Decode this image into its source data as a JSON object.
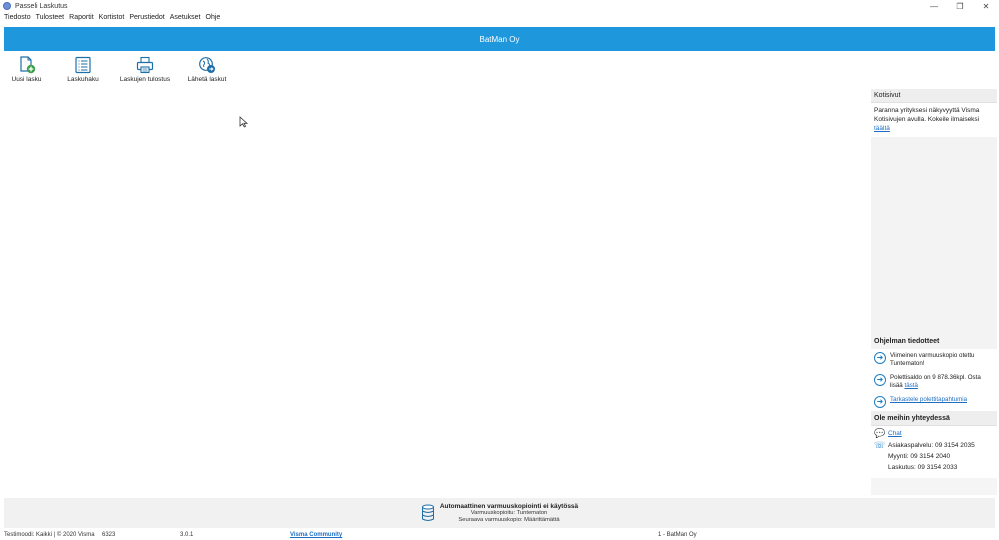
{
  "window": {
    "title": "Passeli Laskutus",
    "controls": [
      "—",
      "❐",
      "✕"
    ]
  },
  "menu": [
    "Tiedosto",
    "Tulosteet",
    "Raportit",
    "Kortistot",
    "Perustiedot",
    "Asetukset",
    "Ohje"
  ],
  "header": {
    "title": "BatMan Oy"
  },
  "toolbar": {
    "new_invoice": "Uusi lasku",
    "invoice_search": "Laskuhaku",
    "invoice_print": "Laskujen tulostus",
    "send_invoices": "Lähetä laskut"
  },
  "colors": {
    "accent": "#1e97dc",
    "link": "#1e6fc4"
  },
  "right_panel": {
    "kotisivut_title": "Kotisivut",
    "kotisivut_text": "Paranna yrityksesi näkyvyyttä Visma Kotisivujen avulla. Kokeile ilmaiseksi",
    "kotisivut_link": "täältä",
    "info_title": "Ohjelman tiedotteet",
    "info_backup": "Viimeinen varmuuskopio otettu Tuntematon!",
    "info_balance": "Polettisaldo on 9 878.36kpl. Osta lisää",
    "info_balance_link": "tästä",
    "info_events_link": "Tarkastele polettitapahtumia",
    "contact_title": "Ole meihin yhteydessä",
    "chat_link": "Chat",
    "support": "Asiakaspalvelu: 09 3154 2035",
    "sales": "Myynti: 09 3154 2040",
    "billing": "Laskutus: 09 3154 2033"
  },
  "backup": {
    "title": "Automaattinen varmuuskopiointi ei käytössä",
    "line1": "Varmuuskopioitu: Tuntematon",
    "line2": "Seuraava varmuuskopio: Määrittämättä"
  },
  "status": {
    "mode": "Testimoodi: Kaikki | © 2020 Visma",
    "num": "6323",
    "version": "3.0.1",
    "community": "Visma Community",
    "company": "1 - BatMan Oy"
  }
}
